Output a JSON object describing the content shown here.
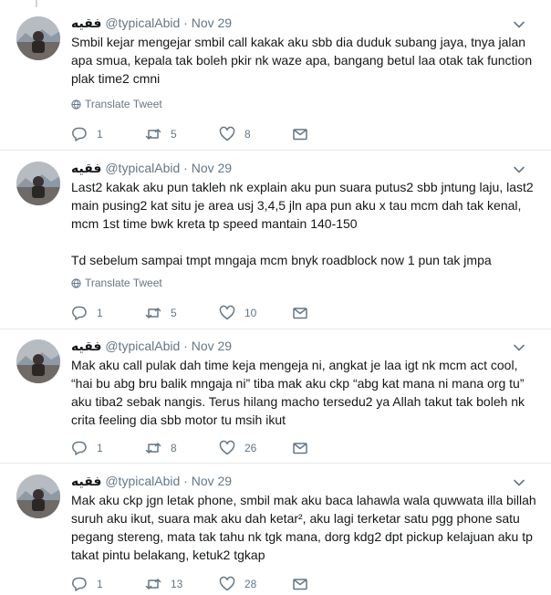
{
  "tweets": [
    {
      "name": "فقيه",
      "handle": "@typicalAbid",
      "dot": "·",
      "date": "Nov 29",
      "text": "Smbil kejar mengejar smbil call kakak aku sbb dia duduk subang jaya, tnya jalan apa smua, kepala tak boleh pkir nk waze apa, bangang betul laa otak tak function plak time2 cmni",
      "translate": "Translate Tweet",
      "replies": "1",
      "retweets": "5",
      "likes": "8"
    },
    {
      "name": "فقيه",
      "handle": "@typicalAbid",
      "dot": "·",
      "date": "Nov 29",
      "text": "Last2 kakak aku pun takleh nk explain aku pun suara putus2 sbb jntung laju, last2 main pusing2 kat situ je area usj 3,4,5 jln apa pun aku x tau mcm dah tak kenal, mcm 1st time bwk kreta tp speed mantain 140-150\n\nTd sebelum sampai tmpt mngaja mcm bnyk roadblock now 1 pun tak jmpa",
      "translate": "Translate Tweet",
      "replies": "1",
      "retweets": "5",
      "likes": "10"
    },
    {
      "name": "فقيه",
      "handle": "@typicalAbid",
      "dot": "·",
      "date": "Nov 29",
      "text": "Mak aku call pulak dah time keja mengeja ni, angkat je laa igt nk mcm act cool, “hai bu abg bru balik mngaja ni” tiba mak aku ckp “abg kat mana ni mana org tu” aku tiba2 sebak nangis. Terus hilang macho tersedu2 ya Allah takut tak boleh nk crita feeling dia sbb motor tu msih ikut",
      "translate": "",
      "replies": "1",
      "retweets": "8",
      "likes": "26"
    },
    {
      "name": "فقيه",
      "handle": "@typicalAbid",
      "dot": "·",
      "date": "Nov 29",
      "text": "Mak aku ckp jgn letak phone, smbil mak aku baca lahawla wala quwwata illa billah suruh aku ikut, suara mak aku dah ketar², aku lagi terketar satu pgg phone satu pegang stereng, mata tak tahu nk tgk mana, dorg kdg2 dpt pickup kelajuan aku tp takat pintu belakang, ketuk2 tgkap",
      "translate": "",
      "replies": "1",
      "retweets": "13",
      "likes": "28"
    }
  ],
  "icons": {
    "reply": "reply-icon",
    "retweet": "retweet-icon",
    "like": "heart-icon",
    "dm": "envelope-icon",
    "caret": "chevron-down-icon",
    "globe": "globe-icon"
  },
  "colors": {
    "text": "#14171a",
    "secondary": "#657786",
    "divider": "#e6ecf0"
  }
}
